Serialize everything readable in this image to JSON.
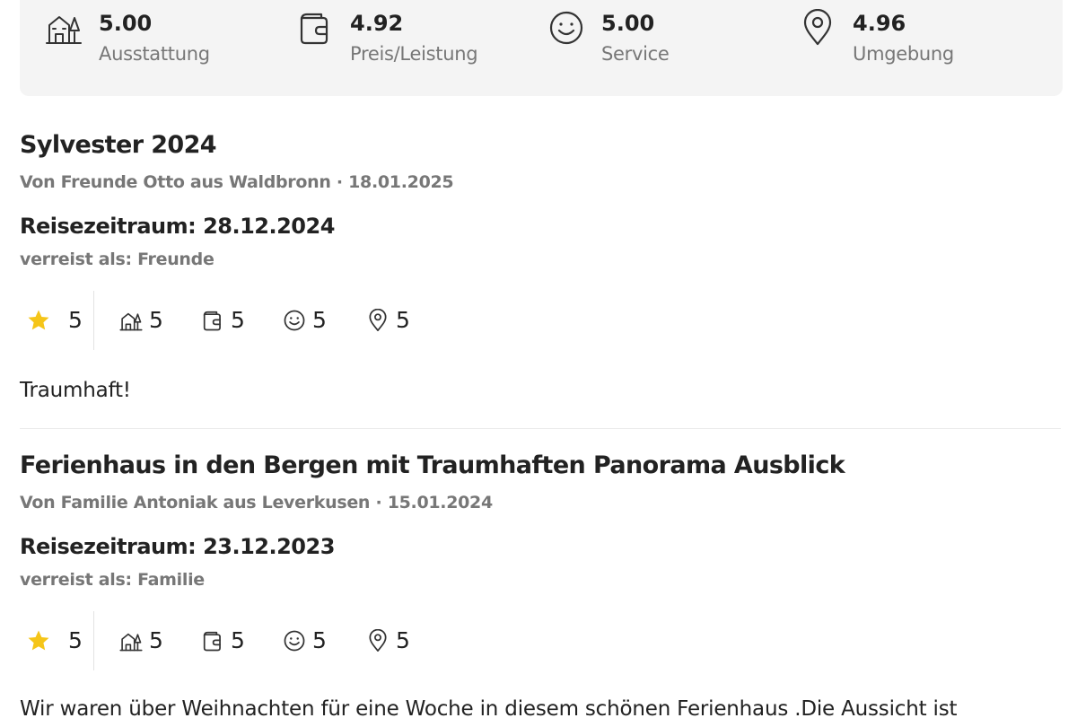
{
  "summary": [
    {
      "icon": "house-icon",
      "score": "5.00",
      "label": "Ausstattung"
    },
    {
      "icon": "wallet-icon",
      "score": "4.92",
      "label": "Preis/Leistung"
    },
    {
      "icon": "smiley-icon",
      "score": "5.00",
      "label": "Service"
    },
    {
      "icon": "location-pin-icon",
      "score": "4.96",
      "label": "Umgebung"
    }
  ],
  "reviews": [
    {
      "title": "Sylvester 2024",
      "meta": "Von Freunde Otto aus Waldbronn · 18.01.2025",
      "period": "Reisezeitraum: 28.12.2024",
      "travel": "verreist als: Freunde",
      "ratings": {
        "overall": "5",
        "ausstattung": "5",
        "preis": "5",
        "service": "5",
        "umgebung": "5"
      },
      "text": "Traumhaft!"
    },
    {
      "title": "Ferienhaus in den Bergen mit Traumhaften Panorama Ausblick",
      "meta": "Von Familie Antoniak aus Leverkusen · 15.01.2024",
      "period": "Reisezeitraum: 23.12.2023",
      "travel": "verreist als: Familie",
      "ratings": {
        "overall": "5",
        "ausstattung": "5",
        "preis": "5",
        "service": "5",
        "umgebung": "5"
      },
      "text": "Wir waren über Weihnachten für eine Woche in diesem schönen Ferienhaus .Die Aussicht ist"
    }
  ],
  "colors": {
    "star": "#f5c518",
    "muted": "#777777",
    "text": "#222222",
    "panel": "#f4f4f4"
  }
}
